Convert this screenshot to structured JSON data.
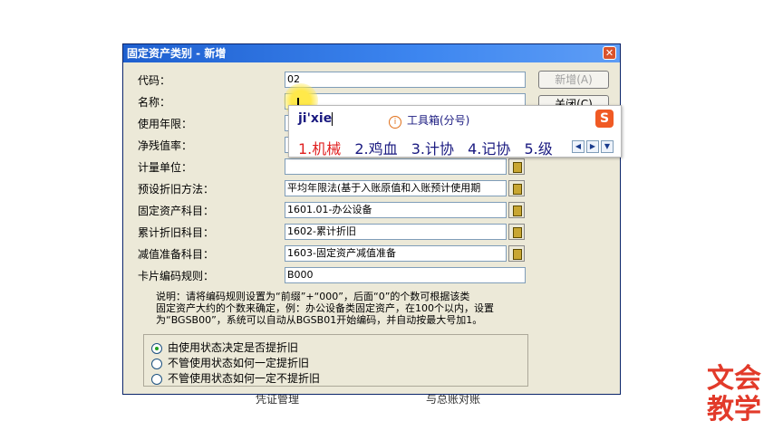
{
  "background": {
    "voucher_label": "凭证管理",
    "reconcile_label": "与总账对账"
  },
  "dialog": {
    "title": "固定资产类别 - 新增",
    "close_glyph": "✕",
    "fields": [
      {
        "label": "代码：",
        "value": ""
      },
      {
        "label": "名称：",
        "value": ""
      },
      {
        "label": "使用年限：",
        "value": ""
      },
      {
        "label": "净残值率：",
        "value": ""
      },
      {
        "label": "计量单位：",
        "value": ""
      },
      {
        "label": "预设折旧方法：",
        "value": "平均年限法(基于入账原值和入账预计使用期"
      },
      {
        "label": "固定资产科目：",
        "value": "1601.01-办公设备"
      },
      {
        "label": "累计折旧科目：",
        "value": "1602-累计折旧"
      },
      {
        "label": "减值准备科目：",
        "value": "1603-固定资产减值准备"
      },
      {
        "label": "卡片编码规则：",
        "value": "B000"
      }
    ],
    "code_value": "02",
    "buttons": {
      "add": "新增(A)",
      "close": "关闭(C)"
    },
    "note": "说明：请将编码规则设置为“前缀”+“000”，后面“0”的个数可根据该类\n固定资产大约的个数来确定，例：办公设备类固定资产，在100个以内，设置\n为“BGSB00”，系统可以自动从BGSB01开始编码，并自动按最大号加1。",
    "radios": [
      {
        "label": "由使用状态决定是否提折旧",
        "checked": true
      },
      {
        "label": "不管使用状态如何一定提折旧",
        "checked": false
      },
      {
        "label": "不管使用状态如何一定不提折旧",
        "checked": false
      }
    ]
  },
  "ime": {
    "pinyin": "ji'xie",
    "toolbox": "工具箱(分号)",
    "logo": "S",
    "candidates": [
      "1.机械",
      "2.鸡血",
      "3.计协",
      "4.记协",
      "5.级"
    ],
    "nav": [
      "◀",
      "▶",
      "▼"
    ]
  },
  "watermark": {
    "line1": "文会",
    "line2": "教学"
  },
  "colors": {
    "titlebar": "#1e5fcf",
    "dialog_bg": "#ece9d8",
    "candidate_first": "#e02020",
    "watermark": "#e23a2a"
  }
}
